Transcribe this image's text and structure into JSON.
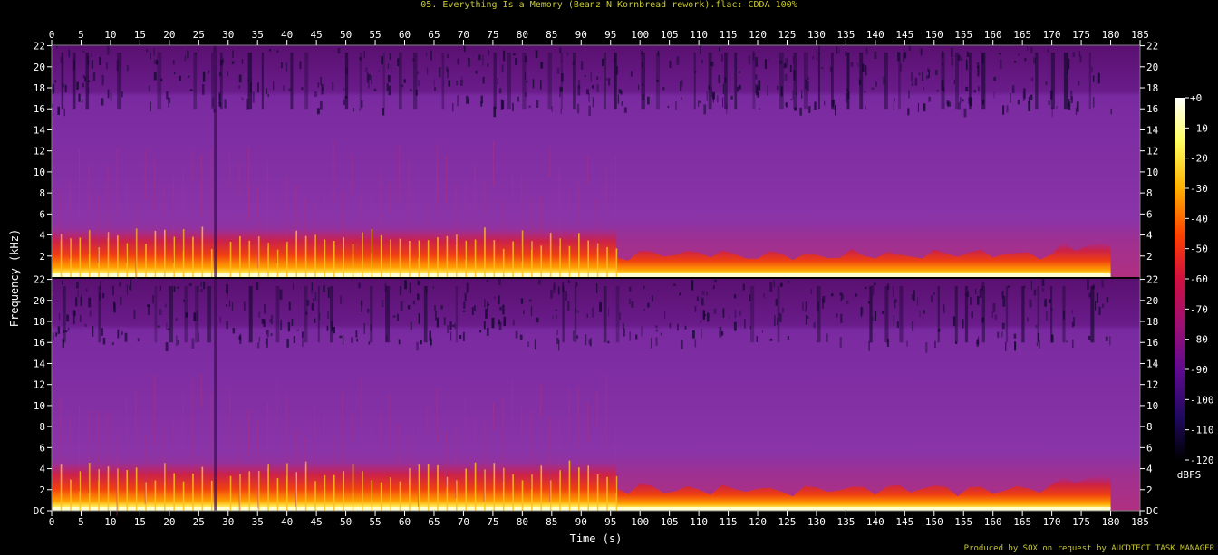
{
  "chart_data": {
    "type": "heatmap",
    "title": "05. Everything Is a Memory (Beanz N Kornbread rework).flac: CDDA 100%",
    "xlabel": "Time (s)",
    "ylabel": "Frequency (kHz)",
    "colorbar_label": "dBFS",
    "credit": "Produced by SOX on request by AUCDTECT TASK MANAGER",
    "xlim": [
      0,
      185
    ],
    "ylim": [
      0,
      22.05
    ],
    "x_ticks": [
      "0",
      "5",
      "10",
      "15",
      "20",
      "25",
      "30",
      "35",
      "40",
      "45",
      "50",
      "55",
      "60",
      "65",
      "70",
      "75",
      "80",
      "85",
      "90",
      "95",
      "100",
      "105",
      "110",
      "115",
      "120",
      "125",
      "130",
      "135",
      "140",
      "145",
      "150",
      "155",
      "160",
      "165",
      "170",
      "175",
      "180",
      "185"
    ],
    "y_ticks": [
      "DC",
      "2",
      "4",
      "6",
      "8",
      "10",
      "12",
      "14",
      "16",
      "18",
      "20",
      "22"
    ],
    "colorbar_ticks": [
      "+0",
      "-10",
      "-20",
      "-30",
      "-40",
      "-50",
      "-60",
      "-70",
      "-80",
      "-90",
      "-100",
      "-110",
      "-120"
    ],
    "colorbar_range": [
      -120,
      0
    ],
    "channels": 2,
    "lowpass_cutoff_khz": 16,
    "beat_section_end_s": 96,
    "break_at_s": 28,
    "music_end_s": 180,
    "colors": {
      "label": "#c8c832",
      "axis": "#ffffff",
      "background": "#000000"
    }
  }
}
